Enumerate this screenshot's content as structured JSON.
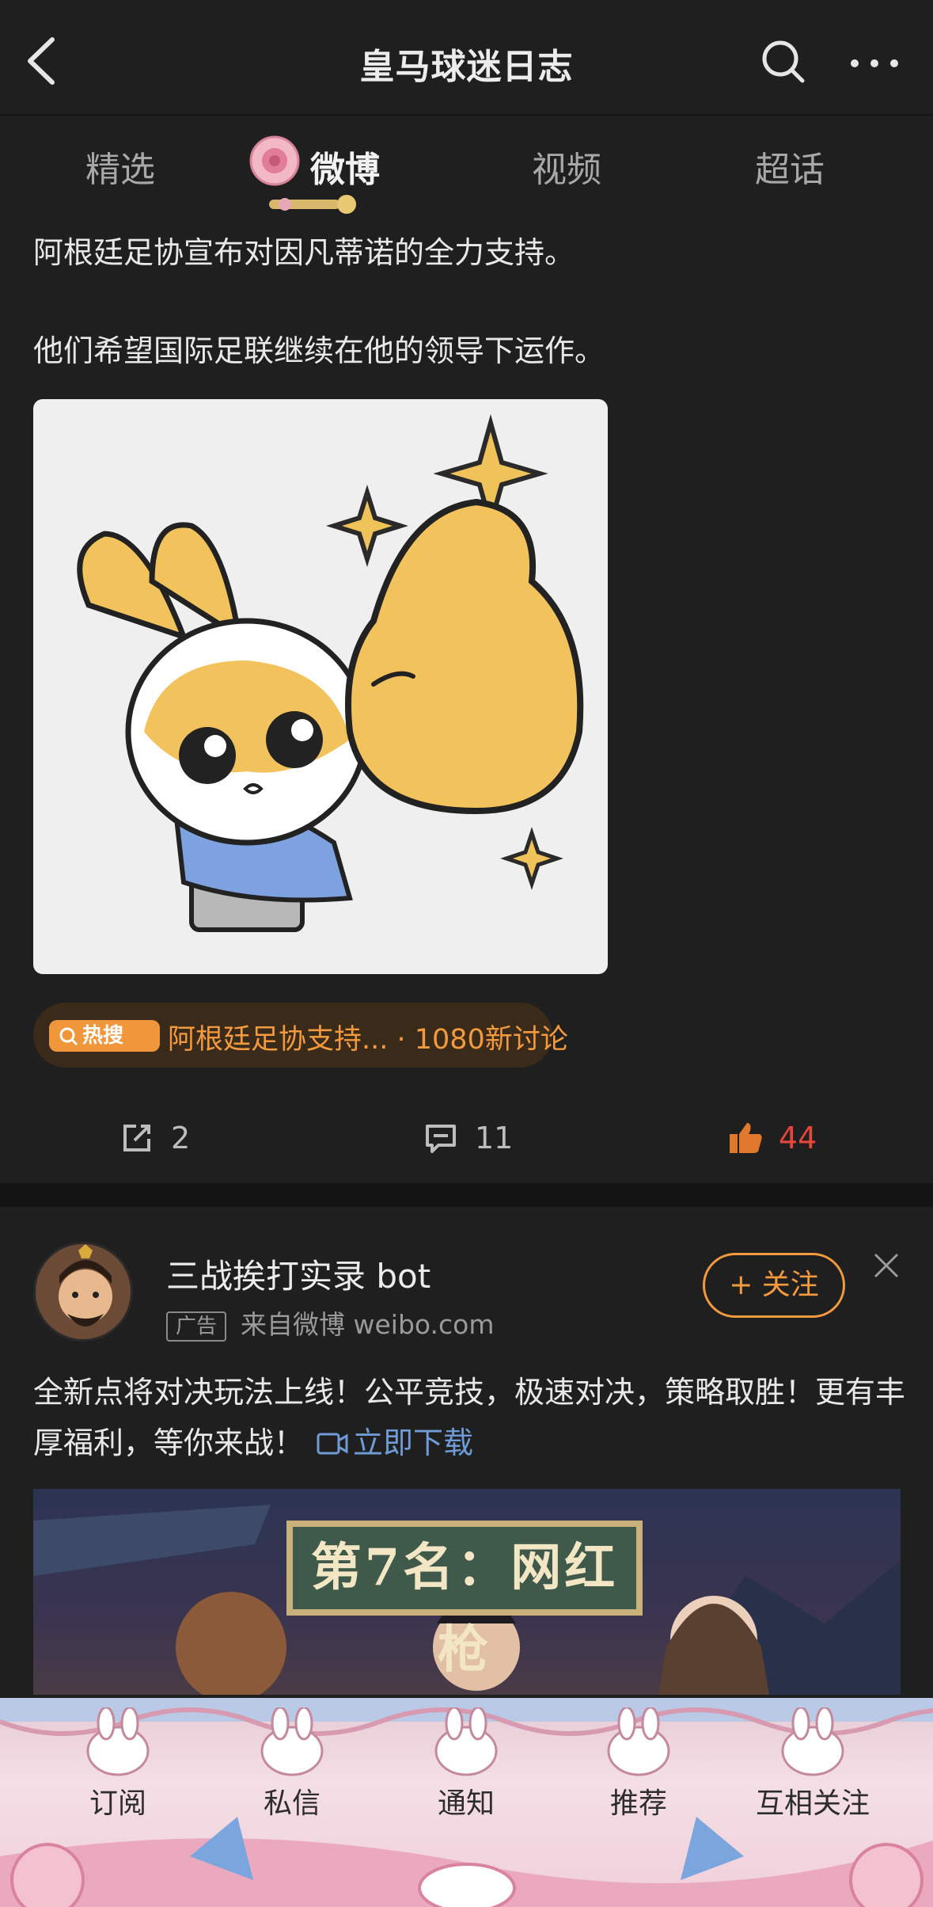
{
  "header": {
    "title": "皇马球迷日志",
    "back_icon": "chevron-left-icon",
    "search_icon": "search-icon",
    "more_icon": "more-horizontal-icon"
  },
  "tabs": [
    {
      "label": "精选",
      "active": false
    },
    {
      "label": "微博",
      "active": true
    },
    {
      "label": "视频",
      "active": false
    },
    {
      "label": "超话",
      "active": false
    }
  ],
  "post": {
    "text_line1": "阿根廷足协宣布对因凡蒂诺的全力支持。",
    "text_line2": "他们希望国际足联继续在他的领导下运作。",
    "hot_badge": "热搜",
    "hot_topic": "阿根廷足协支持... · 1080新讨论",
    "repost_count": "2",
    "comment_count": "11",
    "like_count": "44",
    "like_color": "#e5463c"
  },
  "ad": {
    "name": "三战挨打实录 bot",
    "tag": "广告",
    "source": "来自微博 weibo.com",
    "follow_label": "+ 关注",
    "text": "全新点将对决玩法上线！公平竞技，极速对决，策略取胜！更有丰厚福利，等你来战！",
    "download_label": "立即下载",
    "banner_caption": "第7名：网红枪"
  },
  "bottom_nav": [
    {
      "label": "订阅"
    },
    {
      "label": "私信"
    },
    {
      "label": "通知"
    },
    {
      "label": "推荐"
    },
    {
      "label": "互相关注"
    }
  ],
  "colors": {
    "background": "#1f1f1f",
    "accent_orange": "#f39a3e",
    "link_blue": "#6f9bd6"
  }
}
